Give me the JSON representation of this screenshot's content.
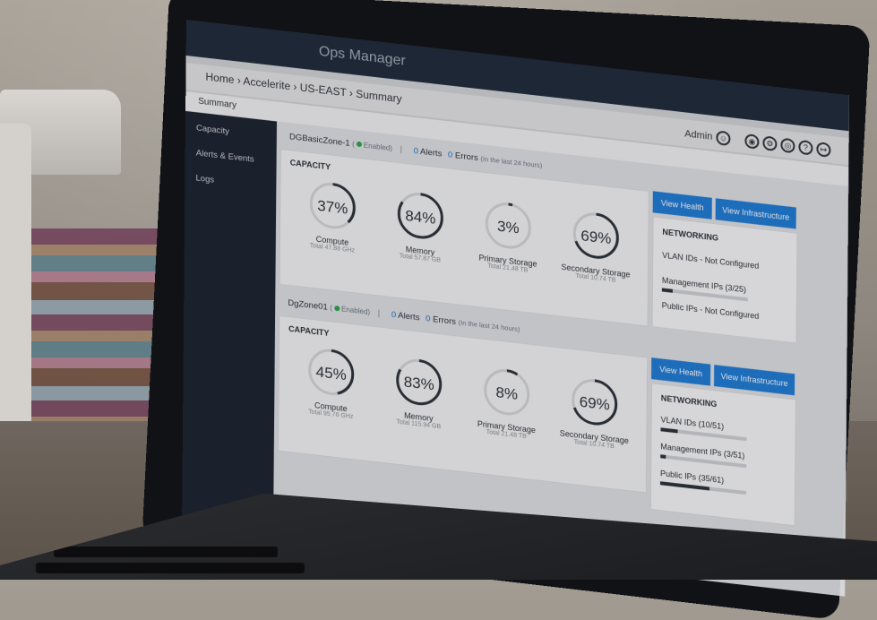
{
  "app": {
    "title": "Ops Manager"
  },
  "breadcrumb": "Home › Accelerite › US-EAST › Summary",
  "header": {
    "user": "Admin"
  },
  "tabs": {
    "active": "Summary"
  },
  "sidebar": {
    "items": [
      {
        "label": "Capacity"
      },
      {
        "label": "Alerts & Events"
      },
      {
        "label": "Logs"
      }
    ]
  },
  "zones": [
    {
      "name": "DGBasicZone-1",
      "status": "Enabled",
      "alerts_count": "0",
      "alerts_label": "Alerts",
      "errors_count": "0",
      "errors_label": "Errors",
      "period": "(In the last 24 hours)",
      "capacity_title": "CAPACITY",
      "buttons": {
        "view_health": "View Health",
        "view_infrastructure": "View Infrastructure"
      },
      "gauges": [
        {
          "pct_text": "37%",
          "value": 37,
          "name": "Compute",
          "total": "Total 47.88 GHz"
        },
        {
          "pct_text": "84%",
          "value": 84,
          "name": "Memory",
          "total": "Total 57.87 GB"
        },
        {
          "pct_text": "3%",
          "value": 3,
          "name": "Primary Storage",
          "total": "Total 21.48 TB"
        },
        {
          "pct_text": "69%",
          "value": 69,
          "name": "Secondary Storage",
          "total": "Total 10.74 TB"
        }
      ],
      "networking": {
        "title": "NETWORKING",
        "rows": [
          {
            "label": "VLAN IDs - Not Configured",
            "fill": null
          },
          {
            "label": "Management IPs (3/25)",
            "fill": 0.12
          },
          {
            "label": "Public IPs - Not Configured",
            "fill": null
          }
        ]
      }
    },
    {
      "name": "DgZone01",
      "status": "Enabled",
      "alerts_count": "0",
      "alerts_label": "Alerts",
      "errors_count": "0",
      "errors_label": "Errors",
      "period": "(In the last 24 hours)",
      "capacity_title": "CAPACITY",
      "buttons": {
        "view_health": "View Health",
        "view_infrastructure": "View Infrastructure"
      },
      "gauges": [
        {
          "pct_text": "45%",
          "value": 45,
          "name": "Compute",
          "total": "Total 95.76 GHz"
        },
        {
          "pct_text": "83%",
          "value": 83,
          "name": "Memory",
          "total": "Total 115.94 GB"
        },
        {
          "pct_text": "8%",
          "value": 8,
          "name": "Primary Storage",
          "total": "Total 21.48 TB"
        },
        {
          "pct_text": "69%",
          "value": 69,
          "name": "Secondary Storage",
          "total": "Total 10.74 TB"
        }
      ],
      "networking": {
        "title": "NETWORKING",
        "rows": [
          {
            "label": "VLAN IDs (10/51)",
            "fill": 0.2
          },
          {
            "label": "Management IPs (3/51)",
            "fill": 0.06
          },
          {
            "label": "Public IPs (35/61)",
            "fill": 0.57
          }
        ]
      }
    }
  ],
  "colors": {
    "accent": "#1f7cd6",
    "enabled": "#2ea24a",
    "sidebar": "#1c2230"
  }
}
